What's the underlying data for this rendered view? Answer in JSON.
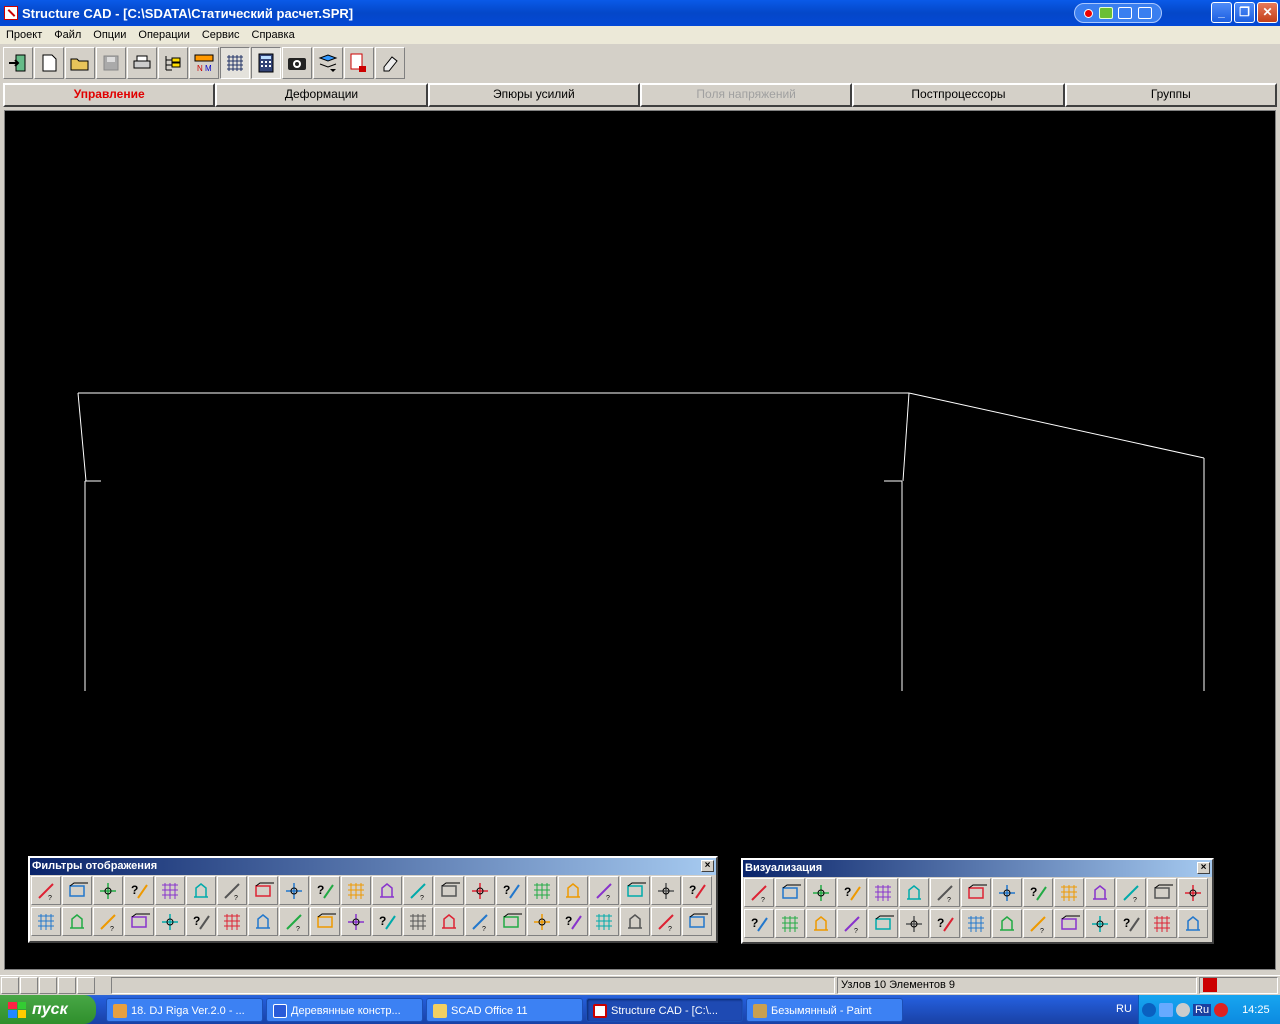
{
  "window": {
    "title": "Structure CAD  - [C:\\SDATA\\Статический расчет.SPR]"
  },
  "menu": [
    "Проект",
    "Файл",
    "Опции",
    "Операции",
    "Сервис",
    "Справка"
  ],
  "toolbar_icons": [
    "exit-icon",
    "new-file-icon",
    "open-folder-icon",
    "save-icon",
    "print-icon",
    "tree-icon",
    "section-icon",
    "grid-mesh-icon",
    "calculator-icon",
    "camera-icon",
    "layers-icon",
    "document-export-icon",
    "eraser-icon"
  ],
  "tabs": [
    {
      "label": "Управление",
      "state": "active"
    },
    {
      "label": "Деформации",
      "state": "normal"
    },
    {
      "label": "Эпюры усилий",
      "state": "normal"
    },
    {
      "label": "Поля напряжений",
      "state": "disabled"
    },
    {
      "label": "Постпроцессоры",
      "state": "normal"
    },
    {
      "label": "Группы",
      "state": "normal"
    }
  ],
  "filter_panel": {
    "title": "Фильтры отображения",
    "close": "×"
  },
  "viz_panel": {
    "title": "Визуализация",
    "close": "×"
  },
  "status": {
    "info": "Узлов 10 Элементов 9"
  },
  "taskbar": {
    "start_label": "пуск",
    "tasks": [
      {
        "label": "18. DJ Riga Ver.2.0 - ..."
      },
      {
        "label": "Деревянные констр..."
      },
      {
        "label": "SCAD Office 11"
      },
      {
        "label": "Structure CAD  - [C:\\..."
      },
      {
        "label": "Безымянный - Paint"
      }
    ],
    "lang": "RU",
    "tray_lang": "Ru",
    "clock": "14:25"
  },
  "colors": {
    "accent_tab": "#e00000",
    "canvas_bg": "#000000",
    "model_lines": "#ffffff"
  }
}
